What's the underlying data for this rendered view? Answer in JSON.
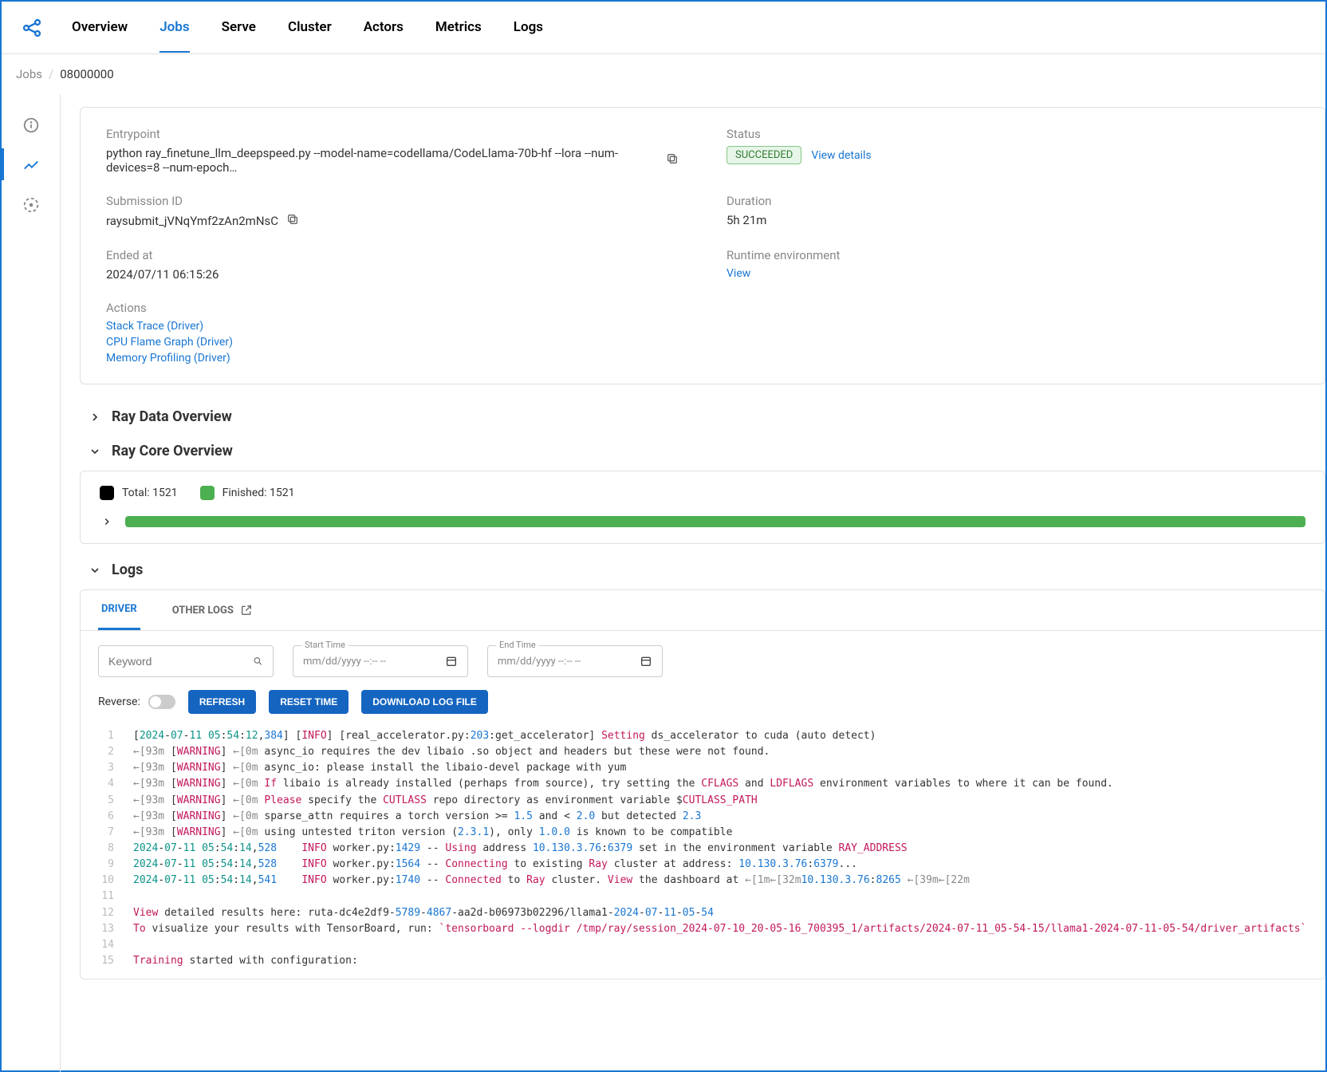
{
  "nav": [
    "Overview",
    "Jobs",
    "Serve",
    "Cluster",
    "Actors",
    "Metrics",
    "Logs"
  ],
  "nav_active": "Jobs",
  "breadcrumb": {
    "parent": "Jobs",
    "current": "08000000"
  },
  "details": {
    "entrypoint_label": "Entrypoint",
    "entrypoint_value": "python ray_finetune_llm_deepspeed.py --model-name=codellama/CodeLlama-70b-hf --lora --num-devices=8 --num-epoch…",
    "status_label": "Status",
    "status_badge": "SUCCEEDED",
    "status_link": "View details",
    "submission_label": "Submission ID",
    "submission_value": "raysubmit_jVNqYmf2zAn2mNsC",
    "duration_label": "Duration",
    "duration_value": "5h 21m",
    "ended_label": "Ended at",
    "ended_value": "2024/07/11 06:15:26",
    "runtime_label": "Runtime environment",
    "runtime_link": "View",
    "actions_label": "Actions",
    "actions": [
      "Stack Trace (Driver)",
      "CPU Flame Graph (Driver)",
      "Memory Profiling (Driver)"
    ]
  },
  "sections": {
    "data_hdr": "Ray Data Overview",
    "core_hdr": "Ray Core Overview",
    "logs_hdr": "Logs"
  },
  "core": {
    "total_label": "Total: 1521",
    "finished_label": "Finished: 1521"
  },
  "logs": {
    "tab1": "DRIVER",
    "tab2": "OTHER LOGS",
    "kw_placeholder": "Keyword",
    "start_label": "Start Time",
    "end_label": "End Time",
    "dt_placeholder": "mm/dd/yyyy --:-- --",
    "reverse_label": "Reverse:",
    "btn_refresh": "REFRESH",
    "btn_reset": "RESET TIME",
    "btn_download": "DOWNLOAD LOG FILE"
  },
  "log_lines": [
    {
      "n": 1,
      "html": "[<span class='c-teal'>2024</span>-<span class='c-teal'>07</span>-<span class='c-teal'>11</span> <span class='c-teal'>05</span>:<span class='c-teal'>54</span>:<span class='c-teal'>12</span>,<span class='c-num'>384</span>] [<span class='c-red'>INFO</span>] [real_accelerator.py:<span class='c-num'>203</span>:get_accelerator] <span class='c-red'>Setting</span> ds_accelerator to cuda (auto detect)"
    },
    {
      "n": 2,
      "html": "<span class='c-grey'>←[93m</span> [<span class='c-red'>WARNING</span>] <span class='c-grey'>←[0m</span> async_io requires the dev libaio .so object and headers but these were not found."
    },
    {
      "n": 3,
      "html": "<span class='c-grey'>←[93m</span> [<span class='c-red'>WARNING</span>] <span class='c-grey'>←[0m</span> async_io: please install the libaio-devel package with yum"
    },
    {
      "n": 4,
      "html": "<span class='c-grey'>←[93m</span> [<span class='c-red'>WARNING</span>] <span class='c-grey'>←[0m</span> <span class='c-red'>If</span> libaio is already installed (perhaps from source), try setting the <span class='c-red'>CFLAGS</span> and <span class='c-red'>LDFLAGS</span> environment variables to where it can be found."
    },
    {
      "n": 5,
      "html": "<span class='c-grey'>←[93m</span> [<span class='c-red'>WARNING</span>] <span class='c-grey'>←[0m</span> <span class='c-red'>Please</span> specify the <span class='c-red'>CUTLASS</span> repo directory as environment variable $<span class='c-red'>CUTLASS_PATH</span>"
    },
    {
      "n": 6,
      "html": "<span class='c-grey'>←[93m</span> [<span class='c-red'>WARNING</span>] <span class='c-grey'>←[0m</span> sparse_attn requires a torch version &gt;= <span class='c-num'>1.5</span> and &lt; <span class='c-num'>2.0</span> but detected <span class='c-num'>2.3</span>"
    },
    {
      "n": 7,
      "html": "<span class='c-grey'>←[93m</span> [<span class='c-red'>WARNING</span>] <span class='c-grey'>←[0m</span> using untested triton version (<span class='c-num'>2.3.1</span>), only <span class='c-num'>1.0.0</span> is known to be compatible"
    },
    {
      "n": 8,
      "html": "<span class='c-teal'>2024</span>-<span class='c-teal'>07</span>-<span class='c-teal'>11</span> <span class='c-teal'>05</span>:<span class='c-teal'>54</span>:<span class='c-teal'>14</span>,<span class='c-num'>528</span>    <span class='c-red'>INFO</span> worker.py:<span class='c-num'>1429</span> -- <span class='c-red'>Using</span> address <span class='c-num'>10.130.3.76</span>:<span class='c-num'>6379</span> set in the environment variable <span class='c-red'>RAY_ADDRESS</span>"
    },
    {
      "n": 9,
      "html": "<span class='c-teal'>2024</span>-<span class='c-teal'>07</span>-<span class='c-teal'>11</span> <span class='c-teal'>05</span>:<span class='c-teal'>54</span>:<span class='c-teal'>14</span>,<span class='c-num'>528</span>    <span class='c-red'>INFO</span> worker.py:<span class='c-num'>1564</span> -- <span class='c-red'>Connecting</span> to existing <span class='c-red'>Ray</span> cluster at address: <span class='c-num'>10.130.3.76</span>:<span class='c-num'>6379</span>..."
    },
    {
      "n": 10,
      "html": "<span class='c-teal'>2024</span>-<span class='c-teal'>07</span>-<span class='c-teal'>11</span> <span class='c-teal'>05</span>:<span class='c-teal'>54</span>:<span class='c-teal'>14</span>,<span class='c-num'>541</span>    <span class='c-red'>INFO</span> worker.py:<span class='c-num'>1740</span> -- <span class='c-red'>Connected</span> to <span class='c-red'>Ray</span> cluster. <span class='c-red'>View</span> the dashboard at <span class='c-grey'>←[1m←[32m</span><span class='c-num'>10.130.3.76</span>:<span class='c-num'>8265</span> <span class='c-grey'>←[39m←[22m</span>"
    },
    {
      "n": 11,
      "html": ""
    },
    {
      "n": 12,
      "html": "<span class='c-red'>View</span> detailed results here: ruta-dc4e2df9-<span class='c-num'>5789</span>-<span class='c-num'>4867</span>-aa2d-b06973b02296/llama1-<span class='c-num'>2024</span>-<span class='c-num'>07</span>-<span class='c-num'>11</span>-<span class='c-num'>05</span>-<span class='c-num'>54</span>"
    },
    {
      "n": 13,
      "html": "<span class='c-red'>To</span> visualize your results with TensorBoard, run: <span class='c-red'>`tensorboard --logdir /tmp/ray/session_2024-07-10_20-05-16_700395_1/artifacts/2024-07-11_05-54-15/llama1-2024-07-11-05-54/driver_artifacts`</span>"
    },
    {
      "n": 14,
      "html": ""
    },
    {
      "n": 15,
      "html": "<span class='c-red'>Training</span> started with configuration:"
    }
  ]
}
